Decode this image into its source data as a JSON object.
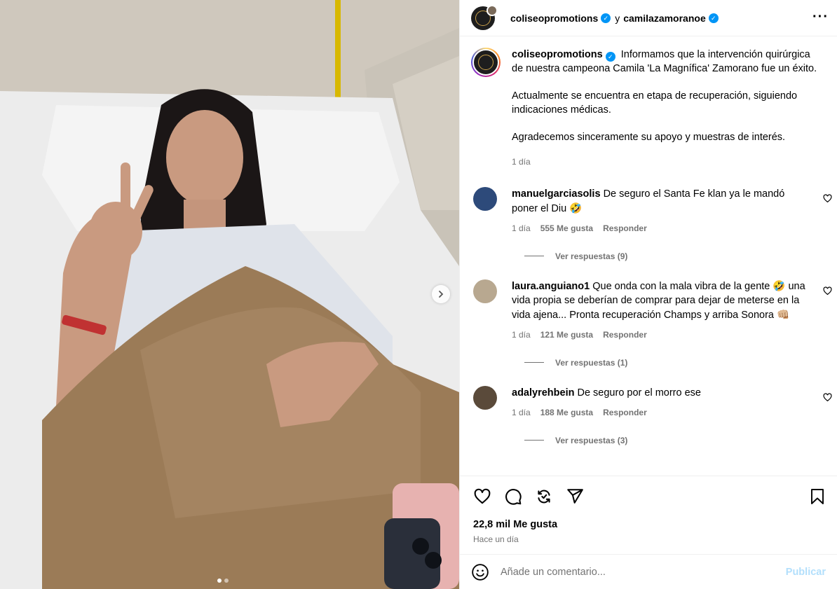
{
  "post": {
    "author": "coliseopromotions",
    "conjunction": "y",
    "collaborator": "camilazamoranoe",
    "more_icon": "more-horizontal-icon",
    "caption_paragraphs": [
      "Informamos que la intervención quirúrgica de nuestra campeona Camila 'La Magnífica' Zamorano fue un éxito.",
      "Actualmente se encuentra en etapa de recuperación, siguiendo indicaciones médicas.",
      "Agradecemos sinceramente su apoyo y muestras de interés."
    ],
    "caption_time": "1 día",
    "carousel": {
      "total": 2,
      "current": 1
    }
  },
  "comments": [
    {
      "user": "manuelgarciasolis",
      "text": "De seguro el Santa Fe klan ya le mandó poner el Diu 🤣",
      "time": "1 día",
      "likes": "555 Me gusta",
      "reply": "Responder",
      "view_replies": "Ver respuestas (9)",
      "avatar_color": "#2d4a7a"
    },
    {
      "user": "laura.anguiano1",
      "text": "Que onda con la mala vibra de la gente 🤣 una vida propia se deberían de comprar para dejar de meterse en la vida ajena... Pronta recuperación Champs y arriba Sonora 👊🏼",
      "time": "1 día",
      "likes": "121 Me gusta",
      "reply": "Responder",
      "view_replies": "Ver respuestas (1)",
      "avatar_color": "#b8a890"
    },
    {
      "user": "adalyrehbein",
      "text": "De seguro por el morro ese",
      "time": "1 día",
      "likes": "188 Me gusta",
      "reply": "Responder",
      "view_replies": "Ver respuestas (3)",
      "avatar_color": "#5a4a3a"
    }
  ],
  "actions": {
    "like_icon": "heart-icon",
    "comment_icon": "comment-icon",
    "repost_icon": "repost-icon",
    "share_icon": "share-icon",
    "save_icon": "bookmark-icon",
    "likes_count": "22,8 mil Me gusta",
    "time_ago": "Hace un día"
  },
  "add_comment": {
    "placeholder": "Añade un comentario...",
    "publish_label": "Publicar",
    "emoji_icon": "emoji-icon"
  },
  "colors": {
    "verified": "#0095f6",
    "secondary_text": "#737373",
    "publish_disabled": "#b2dffc",
    "border": "#efefef"
  }
}
